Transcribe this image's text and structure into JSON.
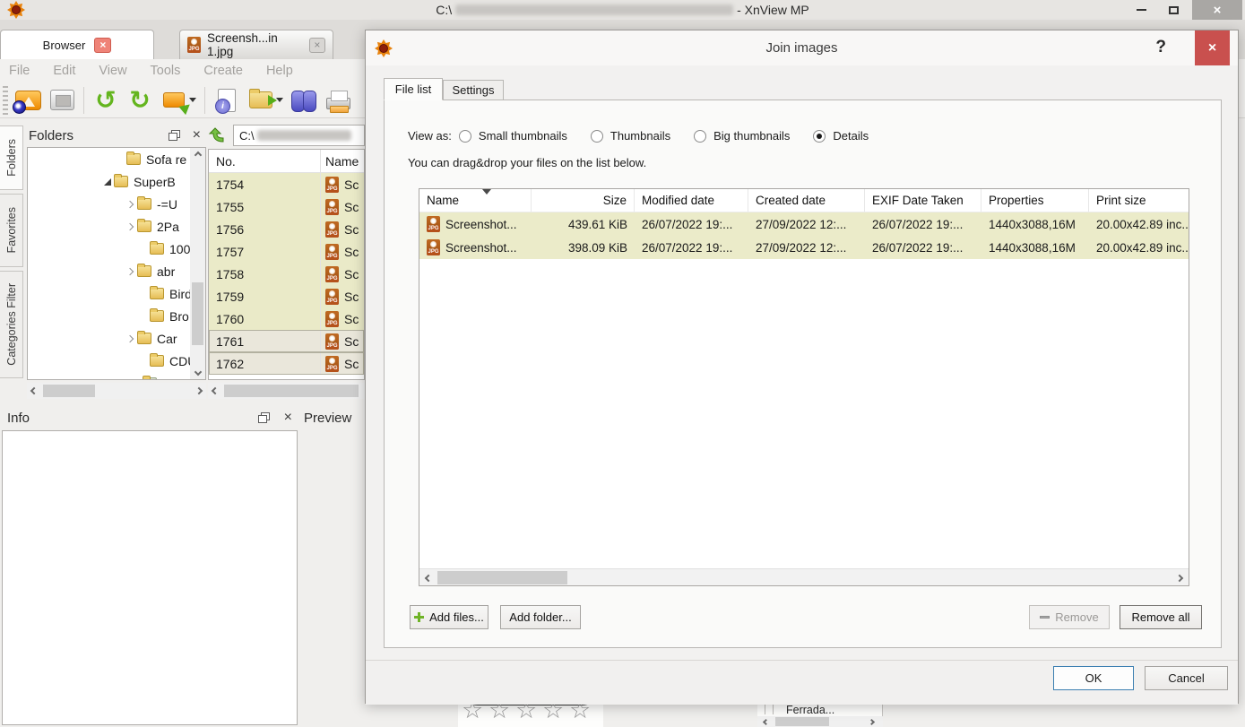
{
  "window": {
    "title_prefix": "C:\\",
    "title_suffix": "- XnView MP",
    "app_tabs": [
      {
        "label": "Browser"
      },
      {
        "label": "Screensh...in 1.jpg"
      }
    ],
    "menu": [
      "File",
      "Edit",
      "View",
      "Tools",
      "Create",
      "Help"
    ]
  },
  "sidebar": {
    "tabs": [
      "Folders",
      "Favorites",
      "Categories Filter"
    ]
  },
  "folders_panel": {
    "title": "Folders",
    "tree": [
      {
        "label": "Sofa re"
      },
      {
        "label": "SuperB"
      },
      {
        "label": "-=U"
      },
      {
        "label": "2Pa"
      },
      {
        "label": "100"
      },
      {
        "label": "abr"
      },
      {
        "label": "Bird"
      },
      {
        "label": "Bro"
      },
      {
        "label": "Car"
      },
      {
        "label": "CDU"
      }
    ]
  },
  "browser": {
    "address_prefix": "C:\\",
    "columns": {
      "no": "No.",
      "name": "Name"
    },
    "rows": [
      {
        "no": "1754",
        "name": "Sc"
      },
      {
        "no": "1755",
        "name": "Sc"
      },
      {
        "no": "1756",
        "name": "Sc"
      },
      {
        "no": "1757",
        "name": "Sc"
      },
      {
        "no": "1758",
        "name": "Sc"
      },
      {
        "no": "1759",
        "name": "Sc"
      },
      {
        "no": "1760",
        "name": "Sc"
      },
      {
        "no": "1761",
        "name": "Sc"
      },
      {
        "no": "1762",
        "name": "Sc"
      }
    ]
  },
  "info_panel": {
    "title": "Info"
  },
  "preview_panel": {
    "title": "Preview"
  },
  "bottom": {
    "ferrada_label": "Ferrada..."
  },
  "dialog": {
    "title": "Join images",
    "tabs": [
      {
        "label": "File list"
      },
      {
        "label": "Settings"
      }
    ],
    "view_as_label": "View as:",
    "view_options": [
      {
        "label": "Small thumbnails",
        "selected": false
      },
      {
        "label": "Thumbnails",
        "selected": false
      },
      {
        "label": "Big thumbnails",
        "selected": false
      },
      {
        "label": "Details",
        "selected": true
      }
    ],
    "dragdrop_hint": "You can drag&drop your files on the list below.",
    "table": {
      "headers": [
        "Name",
        "Size",
        "Modified date",
        "Created date",
        "EXIF Date Taken",
        "Properties",
        "Print size"
      ],
      "rows": [
        {
          "name": "Screenshot...",
          "size": "439.61 KiB",
          "modified": "26/07/2022 19:...",
          "created": "27/09/2022 12:...",
          "exif": "26/07/2022 19:...",
          "properties": "1440x3088,16M",
          "print_size": "20.00x42.89 inc.."
        },
        {
          "name": "Screenshot...",
          "size": "398.09 KiB",
          "modified": "26/07/2022 19:...",
          "created": "27/09/2022 12:...",
          "exif": "26/07/2022 19:...",
          "properties": "1440x3088,16M",
          "print_size": "20.00x42.89 inc.."
        }
      ]
    },
    "buttons": {
      "add_files": "Add files...",
      "add_folder": "Add folder...",
      "remove": "Remove",
      "remove_all": "Remove all",
      "ok": "OK",
      "cancel": "Cancel"
    }
  },
  "icons": {
    "close_glyph": "×",
    "help_glyph": "?",
    "jpg_badge": "JPG"
  },
  "colors": {
    "accent_red": "#c9504e",
    "row_highlight": "#ebebc9",
    "ok_border": "#3c7fb1",
    "folder_yellow": "#e6bd55"
  }
}
